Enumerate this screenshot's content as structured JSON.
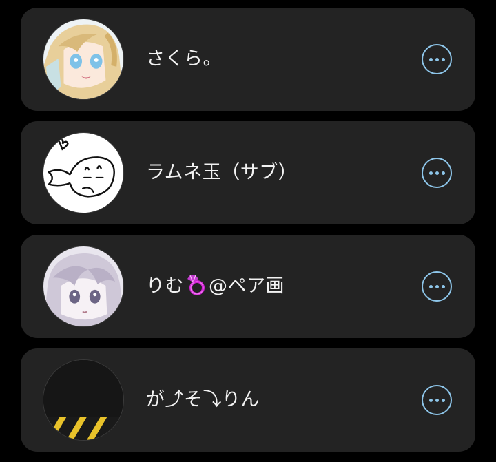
{
  "accent_color": "#8ec6ea",
  "card_background": "#232323",
  "users": [
    {
      "name": "さくら。",
      "avatar_icon": "anime-girl-blonde-avatar",
      "menu_icon": "more-horizontal-icon"
    },
    {
      "name": "ラムネ玉（サブ）",
      "avatar_icon": "doodle-fish-avatar",
      "menu_icon": "more-horizontal-icon"
    },
    {
      "name_prefix": "りむ",
      "name_emoji": "💍",
      "name_suffix": "@ペア画",
      "avatar_icon": "anime-girl-silver-avatar",
      "menu_icon": "more-horizontal-icon"
    },
    {
      "name": "が⤴そ⤵りん",
      "avatar_icon": "dark-caution-stripe-avatar",
      "menu_icon": "more-horizontal-icon"
    }
  ]
}
